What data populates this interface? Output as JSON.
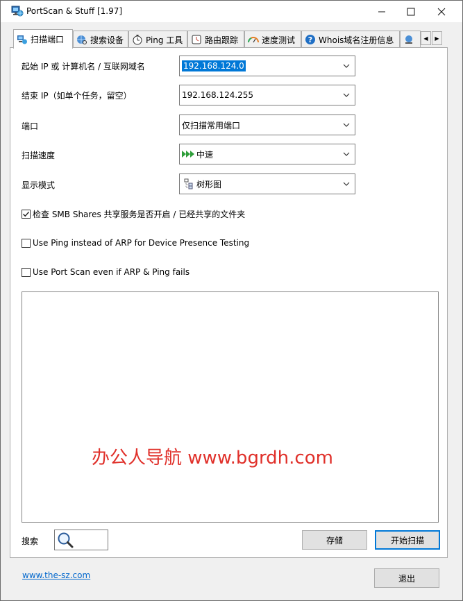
{
  "window": {
    "title": "PortScan & Stuff [1.97]",
    "minimize": "—",
    "maximize": "☐",
    "close": "✕"
  },
  "tabs": [
    {
      "label": "扫描端口",
      "icon": "network-computer-icon",
      "active": true
    },
    {
      "label": "搜索设备",
      "icon": "globe-search-icon",
      "active": false
    },
    {
      "label": "Ping 工具",
      "icon": "stopwatch-icon",
      "active": false
    },
    {
      "label": "路由跟踪",
      "icon": "route-clock-icon",
      "active": false
    },
    {
      "label": "速度测试",
      "icon": "speedometer-icon",
      "active": false
    },
    {
      "label": "Whois域名注册信息",
      "icon": "question-icon",
      "active": false
    }
  ],
  "form": {
    "start_ip_label": "起始 IP 或 计算机名 / 互联网域名",
    "start_ip_value": "192.168.124.0",
    "end_ip_label": "结束 IP（如单个任务，留空）",
    "end_ip_value": "192.168.124.255",
    "port_label": "端口",
    "port_value": "仅扫描常用端口",
    "speed_label": "扫描速度",
    "speed_value": "中速",
    "display_label": "显示模式",
    "display_value": "树形图"
  },
  "options": {
    "smb_label": "检查 SMB Shares 共享服务是否开启 / 已经共享的文件夹",
    "smb_checked": true,
    "ping_label": "Use Ping instead of ARP for Device Presence Testing",
    "ping_checked": false,
    "portscan_label": "Use Port Scan even if ARP & Ping fails",
    "portscan_checked": false
  },
  "results": {
    "watermark": "办公人导航 www.bgrdh.com"
  },
  "bottom": {
    "search_label": "搜索",
    "save_button": "存储",
    "start_button": "开始扫描",
    "link": "www.the-sz.com",
    "exit_button": "退出"
  },
  "colors": {
    "accent": "#0078d7",
    "watermark": "#e0302a",
    "link": "#0066cc"
  }
}
